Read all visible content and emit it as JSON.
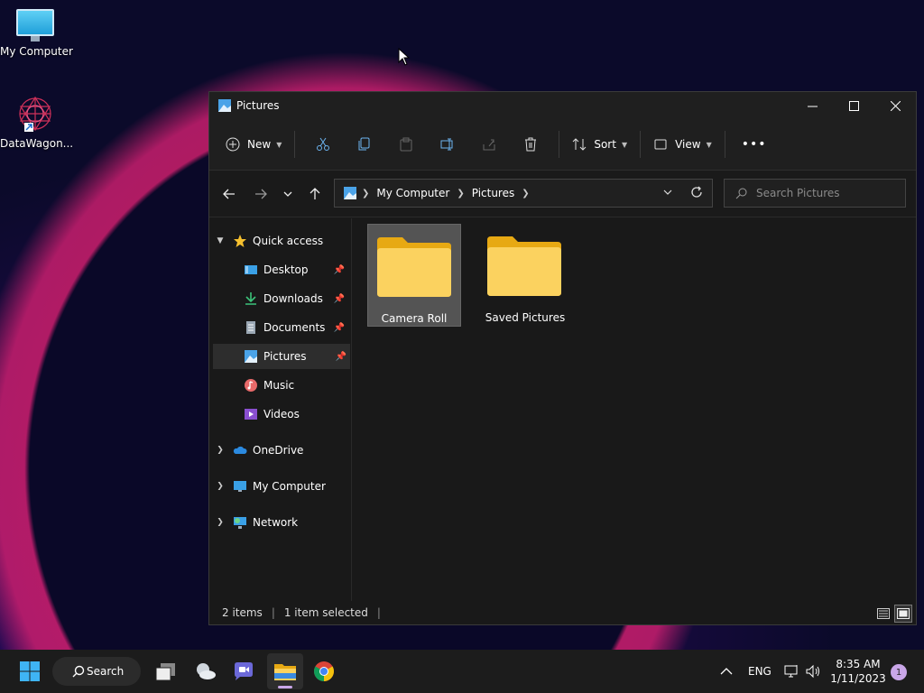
{
  "desktop": {
    "icons": [
      {
        "label": "My Computer",
        "icon": "monitor-icon"
      },
      {
        "label": "DataWagon...",
        "icon": "datawagon-logo-icon"
      }
    ]
  },
  "window": {
    "title": "Pictures",
    "controls": {
      "minimize": "minimize",
      "maximize": "maximize",
      "close": "close"
    }
  },
  "toolbar": {
    "new_label": "New",
    "sort_label": "Sort",
    "view_label": "View",
    "more_label": "•••"
  },
  "address": {
    "crumbs": [
      "My Computer",
      "Pictures"
    ],
    "search_placeholder": "Search Pictures"
  },
  "nav": {
    "quick_access": "Quick access",
    "items": [
      {
        "label": "Desktop",
        "pinned": true
      },
      {
        "label": "Downloads",
        "pinned": true
      },
      {
        "label": "Documents",
        "pinned": true
      },
      {
        "label": "Pictures",
        "pinned": true,
        "selected": true
      },
      {
        "label": "Music",
        "pinned": false
      },
      {
        "label": "Videos",
        "pinned": false
      }
    ],
    "onedrive": "OneDrive",
    "my_computer": "My Computer",
    "network": "Network"
  },
  "content": {
    "folders": [
      {
        "name": "Camera Roll",
        "selected": true
      },
      {
        "name": "Saved Pictures",
        "selected": false
      }
    ]
  },
  "status": {
    "items": "2 items",
    "selected": "1 item selected"
  },
  "taskbar": {
    "search_label": "Search",
    "language": "ENG",
    "time": "8:35 AM",
    "date": "1/11/2023",
    "notification_count": "1"
  },
  "colors": {
    "folder": "#f8c74a",
    "accent": "#4aa3e8",
    "window_bg": "#191919"
  }
}
